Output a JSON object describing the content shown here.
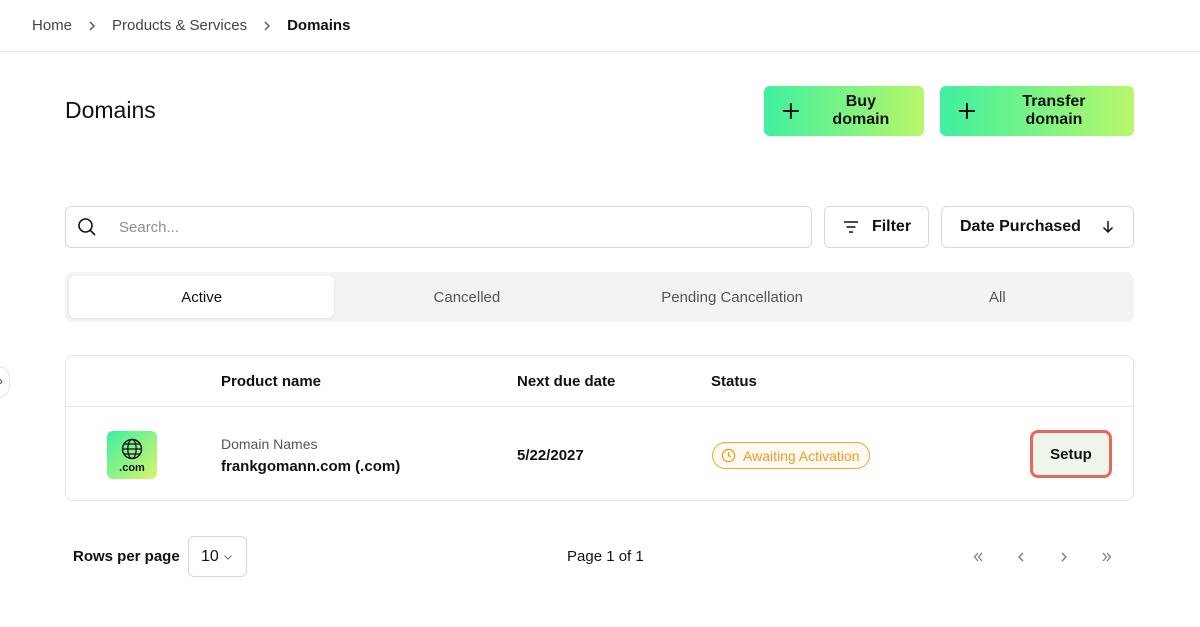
{
  "breadcrumb": {
    "items": [
      "Home",
      "Products & Services",
      "Domains"
    ]
  },
  "page": {
    "title": "Domains"
  },
  "actions": {
    "buy_label": "Buy domain",
    "transfer_label": "Transfer domain"
  },
  "toolbar": {
    "search_placeholder": "Search...",
    "filter_label": "Filter",
    "sort_label": "Date Purchased"
  },
  "tabs": [
    {
      "label": "Active",
      "active": true
    },
    {
      "label": "Cancelled",
      "active": false
    },
    {
      "label": "Pending Cancellation",
      "active": false
    },
    {
      "label": "All",
      "active": false
    }
  ],
  "table": {
    "columns": [
      "Product name",
      "Next due date",
      "Status"
    ],
    "rows": [
      {
        "icon_label": ".com",
        "category": "Domain Names",
        "name": "frankgomann.com (.com)",
        "due_date": "5/22/2027",
        "status": "Awaiting Activation",
        "action_label": "Setup"
      }
    ]
  },
  "pagination": {
    "rows_label": "Rows per page",
    "rows_value": "10",
    "page_info": "Page 1 of 1"
  },
  "colors": {
    "accent_gradient_start": "#3ef0a0",
    "accent_gradient_end": "#b8f76a",
    "status_warning": "#ee9a2a",
    "highlight_border": "#e8665a"
  }
}
